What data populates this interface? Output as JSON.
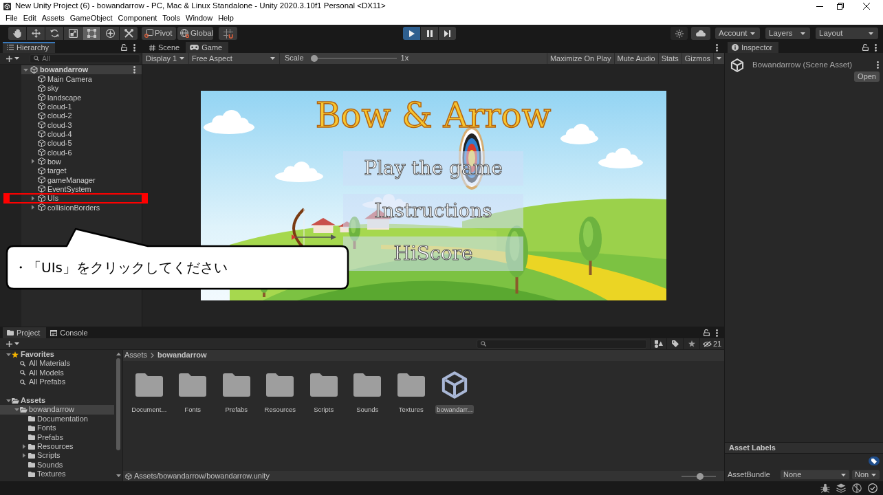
{
  "window": {
    "title": "New Unity Project (6) - bowandarrow - PC, Mac & Linux Standalone - Unity 2020.3.10f1 Personal <DX11>"
  },
  "menu": [
    "File",
    "Edit",
    "Assets",
    "GameObject",
    "Component",
    "Tools",
    "Window",
    "Help"
  ],
  "toolbar": {
    "tools": [
      {
        "kind": "hand",
        "selected": false
      },
      {
        "kind": "move",
        "selected": false
      },
      {
        "kind": "rotate",
        "selected": false
      },
      {
        "kind": "scale",
        "selected": false
      },
      {
        "kind": "rect",
        "selected": true
      },
      {
        "kind": "transform",
        "selected": false
      },
      {
        "kind": "custom",
        "selected": false
      }
    ],
    "handles": [
      {
        "kind": "pivot",
        "label": "Pivot"
      },
      {
        "kind": "global",
        "label": "Global"
      }
    ],
    "playback": [
      {
        "kind": "play",
        "selected": true
      },
      {
        "kind": "pause",
        "selected": false
      },
      {
        "kind": "step",
        "selected": false
      }
    ],
    "menus": [
      "Account",
      "Layers",
      "Layout"
    ]
  },
  "hierarchy": {
    "title": "Hierarchy",
    "focused": true,
    "search": {
      "placeholder": "All"
    },
    "scene": {
      "name": "bowandarrow",
      "expanded": true,
      "children": [
        {
          "name": "Main Camera",
          "foldout": false,
          "selected": false,
          "highlighted": false
        },
        {
          "name": "sky",
          "foldout": false,
          "selected": false,
          "highlighted": false
        },
        {
          "name": "landscape",
          "foldout": false,
          "selected": false,
          "highlighted": false
        },
        {
          "name": "cloud-1",
          "foldout": false,
          "selected": false,
          "highlighted": false
        },
        {
          "name": "cloud-2",
          "foldout": false,
          "selected": false,
          "highlighted": false
        },
        {
          "name": "cloud-3",
          "foldout": false,
          "selected": false,
          "highlighted": false
        },
        {
          "name": "cloud-4",
          "foldout": false,
          "selected": false,
          "highlighted": false
        },
        {
          "name": "cloud-5",
          "foldout": false,
          "selected": false,
          "highlighted": false
        },
        {
          "name": "cloud-6",
          "foldout": false,
          "selected": false,
          "highlighted": false
        },
        {
          "name": "bow",
          "foldout": true,
          "selected": false,
          "highlighted": false
        },
        {
          "name": "target",
          "foldout": false,
          "selected": false,
          "highlighted": false
        },
        {
          "name": "gameManager",
          "foldout": false,
          "selected": false,
          "highlighted": false
        },
        {
          "name": "EventSystem",
          "foldout": false,
          "selected": false,
          "highlighted": false
        },
        {
          "name": "UIs",
          "foldout": true,
          "selected": false,
          "highlighted": true
        },
        {
          "name": "collisionBorders",
          "foldout": true,
          "selected": false,
          "highlighted": false
        }
      ]
    }
  },
  "game_view": {
    "focused": false,
    "tabs": [
      {
        "kind": "scene",
        "label": "Scene",
        "selected": false
      },
      {
        "kind": "game",
        "label": "Game",
        "selected": true
      }
    ],
    "display": "Display 1",
    "aspect": "Free Aspect",
    "scale": {
      "label": "Scale",
      "level": 0,
      "reading": "1x"
    },
    "options": [
      {
        "label": "Maximize On Play",
        "selected": false
      },
      {
        "label": "Mute Audio",
        "selected": false
      },
      {
        "label": "Stats",
        "selected": false
      },
      {
        "label": "Gizmos",
        "selected": false
      }
    ],
    "screen": {
      "title": "Bow & Arrow",
      "buttons": [
        "Play the game",
        "Instructions",
        "HiScore"
      ]
    }
  },
  "inspector": {
    "title": "Inspector",
    "focused": false,
    "asset_title": "Bowandarrow (Scene Asset)",
    "open_button": "Open",
    "labels_header": "Asset Labels",
    "asset_bundle": {
      "label": "AssetBundle",
      "name": "None",
      "variant": "Non"
    }
  },
  "project": {
    "focused": false,
    "tabs": [
      {
        "kind": "project",
        "label": "Project",
        "selected": true
      },
      {
        "kind": "console",
        "label": "Console",
        "selected": false
      }
    ],
    "hidden_count": "21",
    "favorites": {
      "label": "Favorites",
      "expanded": true,
      "items": [
        {
          "name": "All Materials",
          "selected": false
        },
        {
          "name": "All Models",
          "selected": false
        },
        {
          "name": "All Prefabs",
          "selected": false
        }
      ]
    },
    "assets": {
      "label": "Assets",
      "expanded": true,
      "children": [
        {
          "name": "bowandarrow",
          "selected": true,
          "expanded": true,
          "children": [
            {
              "name": "Documentation",
              "foldout": false,
              "selected": false
            },
            {
              "name": "Fonts",
              "foldout": false,
              "selected": false
            },
            {
              "name": "Prefabs",
              "foldout": false,
              "selected": false
            },
            {
              "name": "Resources",
              "foldout": true,
              "selected": false
            },
            {
              "name": "Scripts",
              "foldout": true,
              "selected": false
            },
            {
              "name": "Sounds",
              "foldout": false,
              "selected": false
            },
            {
              "name": "Textures",
              "foldout": false,
              "selected": false
            }
          ]
        }
      ]
    },
    "breadcrumb": [
      "Assets",
      "bowandarrow"
    ],
    "items": [
      {
        "kind": "folder",
        "name": "Document...",
        "selected": false
      },
      {
        "kind": "folder",
        "name": "Fonts",
        "selected": false
      },
      {
        "kind": "folder",
        "name": "Prefabs",
        "selected": false
      },
      {
        "kind": "folder",
        "name": "Resources",
        "selected": false
      },
      {
        "kind": "folder",
        "name": "Scripts",
        "selected": false
      },
      {
        "kind": "folder",
        "name": "Sounds",
        "selected": false
      },
      {
        "kind": "folder",
        "name": "Textures",
        "selected": false
      },
      {
        "kind": "scene",
        "name": "bowandarr...",
        "selected": true
      }
    ],
    "path": "Assets/bowandarrow/bowandarrow.unity",
    "zoom": {
      "level": 0.55
    }
  },
  "callout": {
    "text": "・「UIs」をクリックしてください"
  }
}
